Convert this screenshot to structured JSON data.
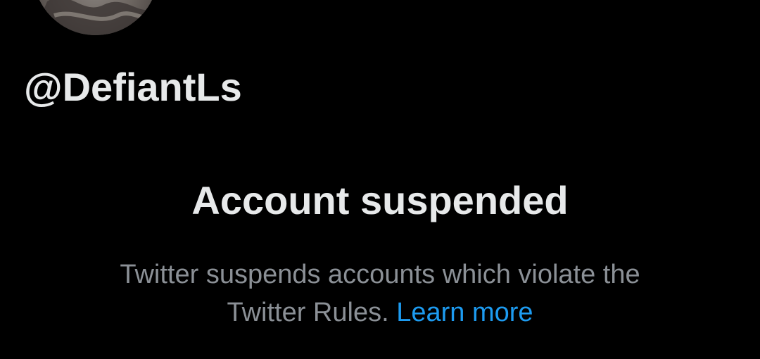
{
  "profile": {
    "handle": "@DefiantLs"
  },
  "suspension": {
    "title": "Account suspended",
    "message_line1": "Twitter suspends accounts which violate the",
    "message_line2": "Twitter Rules.",
    "learn_more_label": "Learn more"
  },
  "colors": {
    "background": "#000000",
    "primary_text": "#e7e9ea",
    "secondary_text": "#8b9096",
    "link": "#1d9bf0"
  },
  "icons": {
    "avatar": "profile-photo"
  }
}
